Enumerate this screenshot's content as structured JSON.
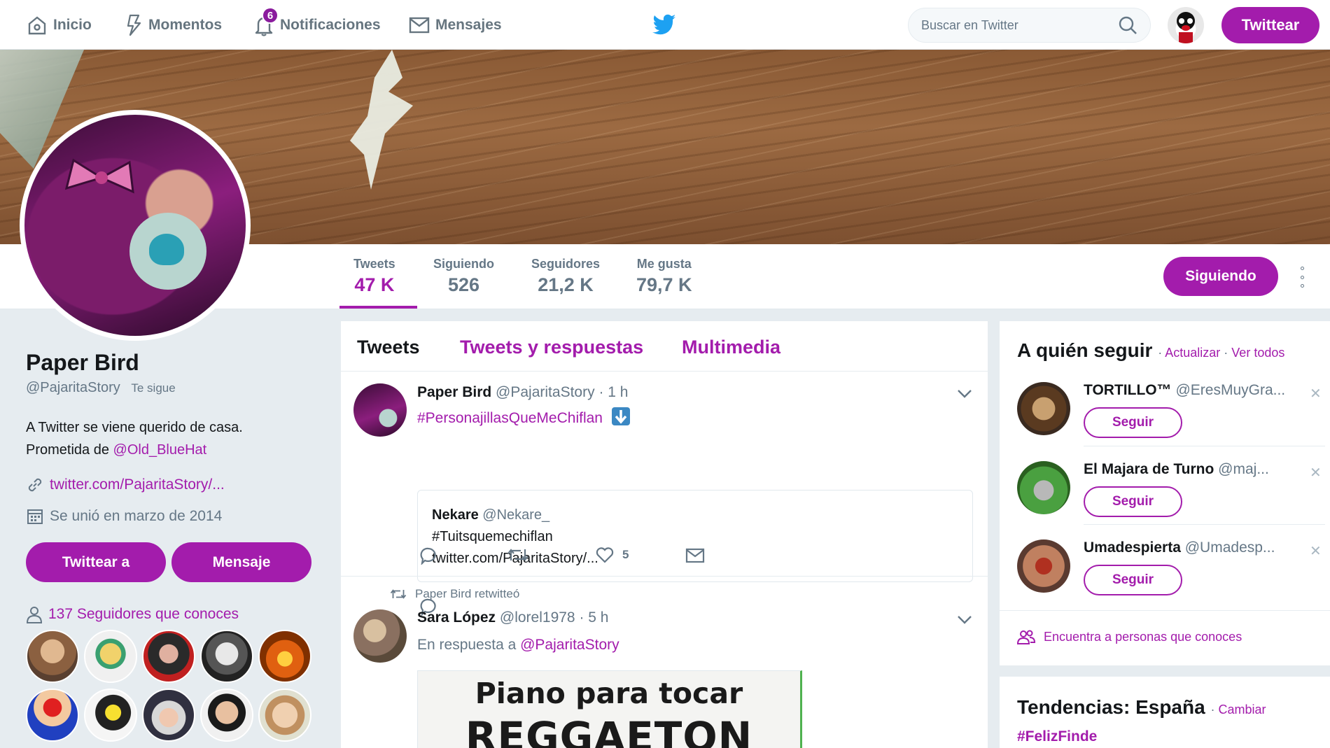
{
  "nav": {
    "home": "Inicio",
    "moments": "Momentos",
    "notifications": "Notificaciones",
    "notifications_count": "6",
    "messages": "Mensajes",
    "search_placeholder": "Buscar en Twitter",
    "tweet_button": "Twittear"
  },
  "profile": {
    "name": "Paper Bird",
    "handle": "@PajaritaStory",
    "follows_you": "Te sigue",
    "bio_line1": "A Twitter se viene querido de casa.",
    "bio_line2_prefix": "Prometida de ",
    "bio_mention": "@Old_BlueHat",
    "website": "twitter.com/PajaritaStory/...",
    "joined": "Se unió en marzo de 2014",
    "tweet_to_button": "Twittear a",
    "message_button": "Mensaje",
    "known_followers": "137 Seguidores que conoces"
  },
  "stats": [
    {
      "label": "Tweets",
      "value": "47 K"
    },
    {
      "label": "Siguiendo",
      "value": "526"
    },
    {
      "label": "Seguidores",
      "value": "21,2 K"
    },
    {
      "label": "Me gusta",
      "value": "79,7 K"
    }
  ],
  "following_button": "Siguiendo",
  "timeline": {
    "tabs": [
      "Tweets",
      "Tweets y respuestas",
      "Multimedia"
    ],
    "tweet1": {
      "name": "Paper Bird",
      "handle": "@PajaritaStory",
      "time": "· 1 h",
      "hashtag": "#PersonajillasQueMeChiflan",
      "quote_name": "Nekare",
      "quote_handle": "@Nekare_",
      "quote_line1": "#Tuitsquemechiflan",
      "quote_line2": "twitter.com/PajaritaStory/...",
      "likes": "5"
    },
    "tweet2": {
      "retweeted_by": "Paper Bird retwitteó",
      "name": "Sara López",
      "handle": "@lorel1978",
      "time": "· 5 h",
      "reply_prefix": "En respuesta a ",
      "reply_mention": "@PajaritaStory",
      "image_line1": "Piano para tocar",
      "image_line2": "REGGAETON"
    }
  },
  "who_to_follow": {
    "title": "A quién seguir",
    "refresh": "Actualizar",
    "view_all": "Ver todos",
    "follow_label": "Seguir",
    "suggestions": [
      {
        "name": "TORTILLO™",
        "handle": "@EresMuyGra..."
      },
      {
        "name": "El Majara de Turno",
        "handle": "@maj..."
      },
      {
        "name": "Umadespierta",
        "handle": "@Umadesp..."
      }
    ],
    "find_people": "Encuentra a personas que conoces"
  },
  "trends": {
    "title": "Tendencias: España",
    "change": "Cambiar",
    "first": "#FelizFinde"
  },
  "colors": {
    "accent": "#a31cac",
    "twitter_blue": "#1da1f2",
    "muted": "#657786"
  }
}
